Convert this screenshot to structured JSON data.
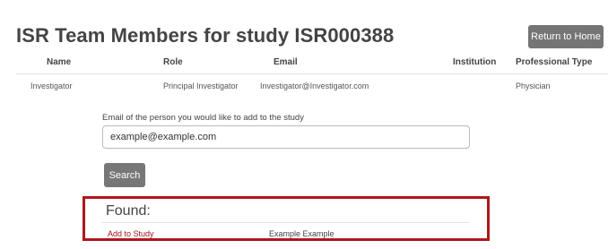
{
  "page": {
    "title": "ISR Team Members for study ISR000388",
    "return_label": "Return to Home"
  },
  "table": {
    "headers": [
      "Name",
      "Role",
      "Email",
      "Institution",
      "Professional Type"
    ],
    "rows": [
      [
        "Investigator",
        "Principal Investigator",
        "Investigator@Investigator.com",
        "",
        "Physician"
      ]
    ]
  },
  "search": {
    "prompt": "Email of the person you would like to add to the study",
    "value": "example@example.com",
    "button_label": "Search"
  },
  "found": {
    "label": "Found:",
    "add_link": "Add to Study",
    "name": "Example Example"
  },
  "colors": {
    "highlight": "#b0161d",
    "link": "#a0141c",
    "button": "#757575"
  }
}
